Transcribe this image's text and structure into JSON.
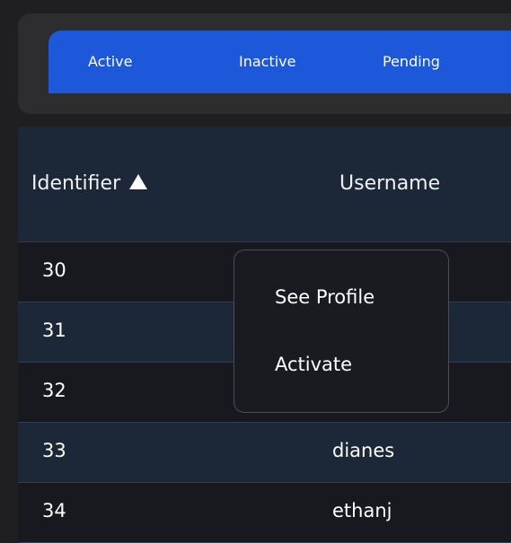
{
  "tabs": [
    {
      "label": "Active"
    },
    {
      "label": "Inactive"
    },
    {
      "label": "Pending"
    }
  ],
  "table": {
    "columns": {
      "identifier": "Identifier",
      "username": "Username"
    },
    "sort": {
      "column": "identifier",
      "direction": "ascending",
      "icon": "triangle-up-icon"
    },
    "rows": [
      {
        "id": "30",
        "username": ""
      },
      {
        "id": "31",
        "username": ""
      },
      {
        "id": "32",
        "username": ""
      },
      {
        "id": "33",
        "username": "dianes"
      },
      {
        "id": "34",
        "username": "ethanj"
      }
    ]
  },
  "context_menu": {
    "items": [
      {
        "label": "See Profile"
      },
      {
        "label": "Activate"
      }
    ]
  },
  "colors": {
    "background": "#1f1f21",
    "tab_bar": "#1d58da",
    "header_row": "#1c2838",
    "alt_row": "#1c2838",
    "menu_bg": "#1a1b20"
  }
}
